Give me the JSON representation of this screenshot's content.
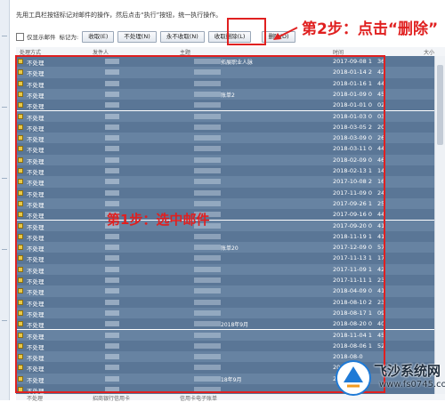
{
  "instruction": "先用工具栏按钮标记对邮件的操作，然后点击“执行”按钮，统一执行操作。",
  "toolbar": {
    "checkbox_label": "仅显示邮件",
    "mark_label": "标记为:",
    "buttons": [
      "收取(E)",
      "不处理(N)",
      "永不收取(N)",
      "收取删除(L)"
    ],
    "delete_label": "删除(D)"
  },
  "annotations": {
    "step1": "第1步：选中邮件",
    "step2": "第2步：点击“删除”"
  },
  "columns": {
    "action": "处理方式",
    "sender": "发件人",
    "subject": "主题",
    "time": "时间",
    "size": "大小"
  },
  "rows": [
    {
      "action": "不处理",
      "subject": "拓展职业人脉",
      "time": "2017-09-08 1",
      "tail": "36"
    },
    {
      "action": "不处理",
      "subject": "",
      "time": "2018-01-14 2",
      "tail": "42"
    },
    {
      "action": "不处理",
      "subject": "",
      "time": "2018-01-16 1",
      "tail": "44"
    },
    {
      "action": "不处理",
      "subject": "账单2",
      "time": "2018-01-09 0",
      "tail": "45"
    },
    {
      "action": "不处理",
      "subject": "",
      "time": "2018-01-01 0",
      "tail": "02"
    },
    {
      "action": "不处理",
      "subject": "",
      "time": "2018-01-03 0",
      "tail": "03"
    },
    {
      "action": "不处理",
      "subject": "",
      "time": "2018-03-05 2",
      "tail": "20"
    },
    {
      "action": "不处理",
      "subject": "",
      "time": "2018-03-09 0",
      "tail": "26"
    },
    {
      "action": "不处理",
      "subject": "",
      "time": "2018-03-11 0",
      "tail": "44"
    },
    {
      "action": "不处理",
      "subject": "",
      "time": "2018-02-09 0",
      "tail": "46"
    },
    {
      "action": "不处理",
      "subject": "",
      "time": "2018-02-13 1",
      "tail": "14"
    },
    {
      "action": "不处理",
      "subject": "",
      "time": "2017-10-08 2",
      "tail": "16"
    },
    {
      "action": "不处理",
      "subject": "",
      "time": "2017-11-09 0",
      "tail": "24"
    },
    {
      "action": "不处理",
      "subject": "",
      "time": "2017-09-26 1",
      "tail": "25"
    },
    {
      "action": "不处理",
      "subject": "",
      "time": "2017-09-16 0",
      "tail": "44"
    },
    {
      "action": "不处理",
      "subject": "",
      "time": "2017-09-20 0",
      "tail": "41"
    },
    {
      "action": "不处理",
      "subject": "",
      "time": "2018-11-19 1",
      "tail": "41"
    },
    {
      "action": "不处理",
      "subject": "账单20",
      "time": "2017-12-09 0",
      "tail": "57"
    },
    {
      "action": "不处理",
      "subject": "",
      "time": "2017-11-13 1",
      "tail": "17"
    },
    {
      "action": "不处理",
      "subject": "",
      "time": "2017-11-09 1",
      "tail": "42"
    },
    {
      "action": "不处理",
      "subject": "",
      "time": "2017-11-11 1",
      "tail": "23"
    },
    {
      "action": "不处理",
      "subject": "",
      "time": "2018-04-09 0",
      "tail": "41"
    },
    {
      "action": "不处理",
      "subject": "",
      "time": "2018-08-10 2",
      "tail": "23"
    },
    {
      "action": "不处理",
      "subject": "",
      "time": "2018-08-17 1",
      "tail": "09"
    },
    {
      "action": "不处理",
      "subject": "2018年9月",
      "time": "2018-08-20 0",
      "tail": "40"
    },
    {
      "action": "不处理",
      "subject": "",
      "time": "2018-11-04 1",
      "tail": "45"
    },
    {
      "action": "不处理",
      "subject": "",
      "time": "2018-08-06 1",
      "tail": "52"
    },
    {
      "action": "不处理",
      "subject": "",
      "time": "2018-08-0",
      "tail": ""
    },
    {
      "action": "不处理",
      "subject": "",
      "time": "2018-0",
      "tail": ""
    },
    {
      "action": "不处理",
      "subject": "18年9月",
      "time": "2018-",
      "tail": ""
    },
    {
      "action": "不处理",
      "subject": "",
      "time": "",
      "tail": ""
    }
  ],
  "footer": {
    "action": "不处理",
    "sender": "招商银行信用卡",
    "subject": "信用卡电子账单"
  },
  "watermark": {
    "title": "飞沙系统网",
    "url": "www.fs0745.com"
  },
  "colors": {
    "selection": "#5a7696",
    "annotation_red": "#e02020",
    "button_face": "#e3e8ef"
  }
}
